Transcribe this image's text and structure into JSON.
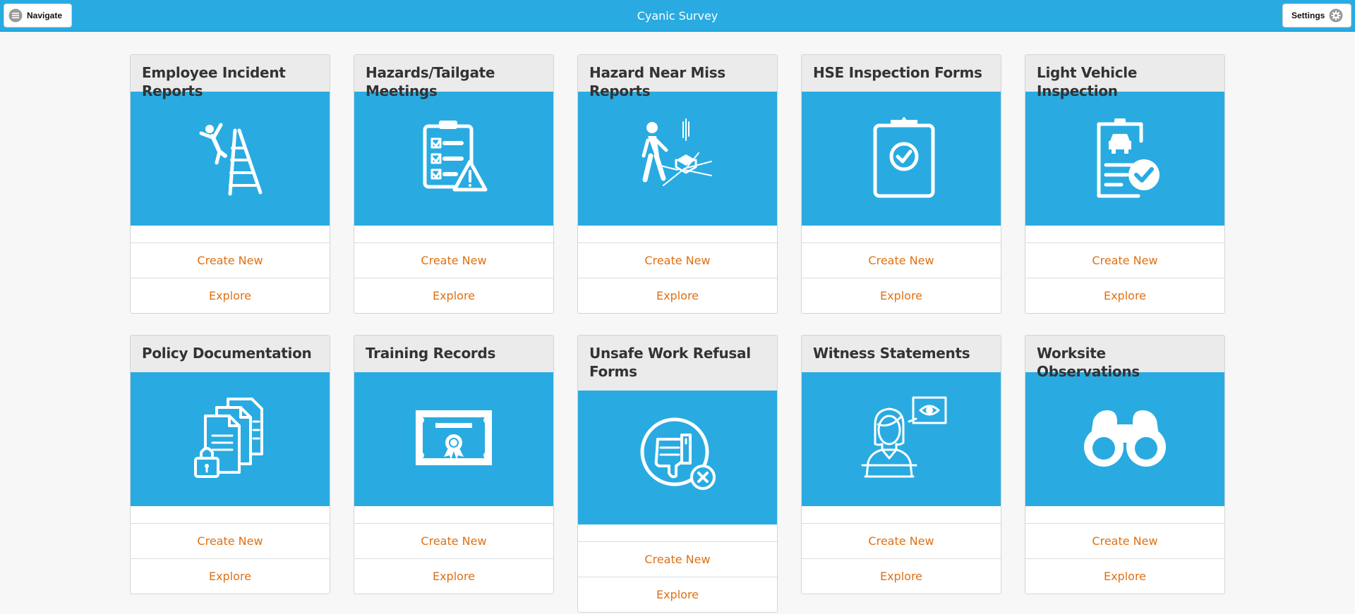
{
  "app": {
    "title": "Cyanic Survey"
  },
  "topbar": {
    "navigate_label": "Navigate",
    "navigate_icon": "hamburger-menu-icon",
    "settings_label": "Settings",
    "settings_icon": "gear-icon"
  },
  "colors": {
    "accent": "#29abe2",
    "action": "#e07012",
    "header_bg": "#ebebeb"
  },
  "cards": [
    {
      "title": "Employee Incident Reports",
      "icon": "falling-ladder-icon",
      "create_label": "Create New",
      "explore_label": "Explore"
    },
    {
      "title": "Hazards/Tailgate Meetings",
      "icon": "checklist-warning-icon",
      "create_label": "Create New",
      "explore_label": "Explore"
    },
    {
      "title": "Hazard Near Miss Reports",
      "icon": "near-miss-falling-object-icon",
      "create_label": "Create New",
      "explore_label": "Explore"
    },
    {
      "title": "HSE Inspection Forms",
      "icon": "clipboard-check-icon",
      "create_label": "Create New",
      "explore_label": "Explore"
    },
    {
      "title": "Light Vehicle Inspection",
      "icon": "vehicle-inspection-icon",
      "create_label": "Create New",
      "explore_label": "Explore"
    },
    {
      "title": "Policy Documentation",
      "icon": "documents-lock-icon",
      "create_label": "Create New",
      "explore_label": "Explore"
    },
    {
      "title": "Training Records",
      "icon": "certificate-icon",
      "create_label": "Create New",
      "explore_label": "Explore"
    },
    {
      "title": "Unsafe Work Refusal Forms",
      "icon": "thumbs-down-refusal-icon",
      "create_label": "Create New",
      "explore_label": "Explore"
    },
    {
      "title": "Witness Statements",
      "icon": "witness-eye-icon",
      "create_label": "Create New",
      "explore_label": "Explore"
    },
    {
      "title": "Worksite Observations",
      "icon": "binoculars-icon",
      "create_label": "Create New",
      "explore_label": "Explore"
    }
  ]
}
